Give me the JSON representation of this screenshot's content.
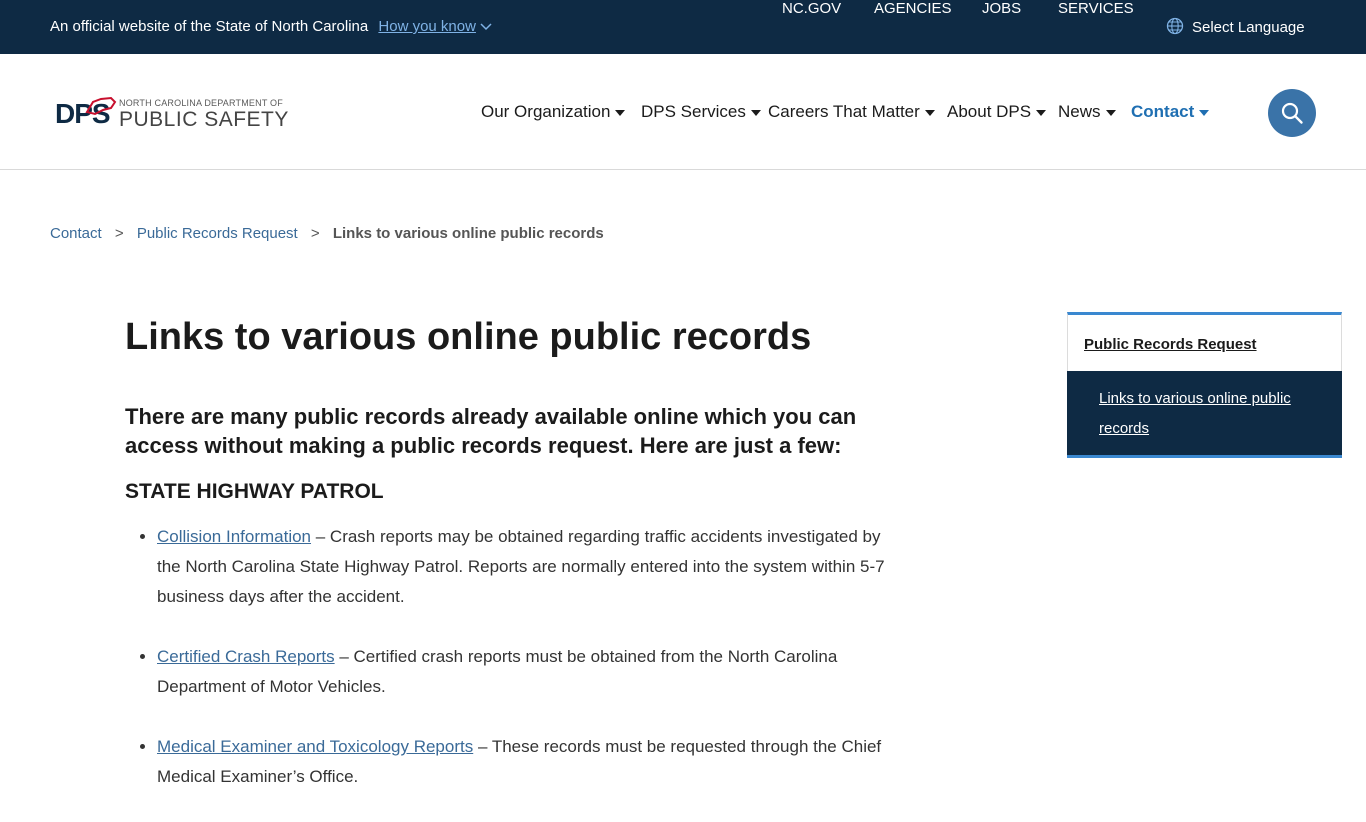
{
  "topbar": {
    "official_text": "An official website of the State of North Carolina",
    "how_you_know": "How you know",
    "links": [
      "NC.GOV",
      "AGENCIES",
      "JOBS",
      "SERVICES"
    ],
    "language": "Select Language"
  },
  "header": {
    "logo_small": "NORTH CAROLINA DEPARTMENT OF",
    "logo_big": "PUBLIC SAFETY",
    "logo_mark": "DPS",
    "nav": [
      {
        "label": "Our Organization"
      },
      {
        "label": "DPS Services"
      },
      {
        "label": "Careers That Matter"
      },
      {
        "label": "About DPS"
      },
      {
        "label": "News"
      },
      {
        "label": "Contact"
      }
    ]
  },
  "breadcrumb": {
    "items": [
      "Contact",
      "Public Records Request"
    ],
    "separator": ">",
    "current": "Links to various online public records"
  },
  "main": {
    "title": "Links to various online public records",
    "intro": "There are many public records already available online which you can access without making a public records request. Here are just a few:",
    "section": "STATE HIGHWAY PATROL",
    "records": [
      {
        "link": "Collision Information",
        "text": " – Crash reports may be obtained regarding traffic accidents investigated by the North Carolina State Highway Patrol. Reports are normally entered into the system within 5-7 business days after the accident."
      },
      {
        "link": "Certified Crash Reports",
        "text": " – Certified crash reports must be obtained from the North Carolina Department of Motor Vehicles."
      },
      {
        "link": "Medical Examiner and Toxicology Reports",
        "text": " – These records must be requested through the Chief Medical Examiner’s Office."
      }
    ]
  },
  "sidebar": {
    "parent": "Public Records Request",
    "active": "Links to various online public records"
  },
  "colors": {
    "navy": "#0e2a44",
    "accent_blue": "#1f6fb2",
    "link_blue": "#3a6a98",
    "search_button": "#3a73a8",
    "sidebar_border": "#3a88d0"
  },
  "icons": [
    "chevron-down-icon",
    "globe-icon",
    "search-icon"
  ]
}
